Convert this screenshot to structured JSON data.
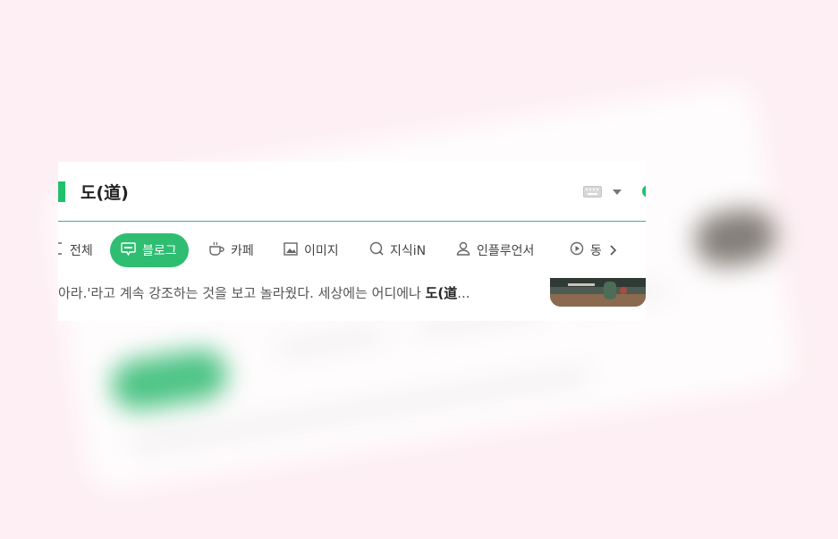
{
  "search": {
    "query": "도(道)"
  },
  "tabs": [
    {
      "label": "전체",
      "icon": "all-icon",
      "active": false
    },
    {
      "label": "블로그",
      "icon": "blog-icon",
      "active": true
    },
    {
      "label": "카페",
      "icon": "cafe-icon",
      "active": false
    },
    {
      "label": "이미지",
      "icon": "image-icon",
      "active": false
    },
    {
      "label": "지식iN",
      "icon": "knowledge-icon",
      "active": false
    },
    {
      "label": "인플루언서",
      "icon": "influencer-icon",
      "active": false
    },
    {
      "label": "동",
      "icon": "video-icon",
      "active": false
    }
  ],
  "result": {
    "snippet_prefix": "아라.'라고 계속 강조하는 것을 보고 놀라웠다. 세상에는 어디에나 ",
    "snippet_highlight": "도(道",
    "snippet_suffix": "..."
  },
  "colors": {
    "accent": "#2fbd72",
    "background": "#fdeff3"
  }
}
